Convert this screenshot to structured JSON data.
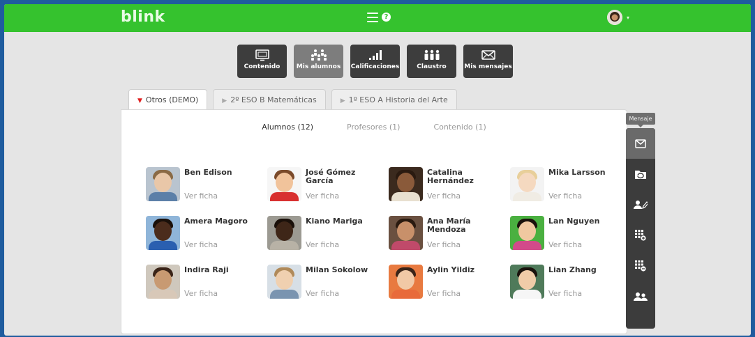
{
  "header": {
    "logo": "blink",
    "help_symbol": "?",
    "menu_icon": "hamburger-icon",
    "avatar_caret": "▾"
  },
  "toolbar": [
    {
      "label": "Contenido",
      "icon": "monitor-icon",
      "active": false
    },
    {
      "label": "Mis alumnos",
      "icon": "students-icon",
      "active": true
    },
    {
      "label": "Calificaciones",
      "icon": "bar-chart-icon",
      "active": false
    },
    {
      "label": "Claustro",
      "icon": "staff-icon",
      "active": false
    },
    {
      "label": "Mis mensajes",
      "icon": "envelope-icon",
      "active": false
    }
  ],
  "tabs": [
    {
      "label": "Otros (DEMO)",
      "active": true,
      "marker": "▼"
    },
    {
      "label": "2º ESO B Matemáticas",
      "active": false,
      "marker": "▶"
    },
    {
      "label": "1º ESO A Historia del Arte",
      "active": false,
      "marker": "▶"
    }
  ],
  "subtabs": [
    {
      "label": "Alumnos (12)",
      "active": true
    },
    {
      "label": "Profesores (1)",
      "active": false
    },
    {
      "label": "Contenido (1)",
      "active": false
    }
  ],
  "students_link_label": "Ver ficha",
  "students": [
    {
      "name": "Ben Edison",
      "skin": "#e9c7a8",
      "hair": "#8a6a45",
      "shirt": "#5b7fa8",
      "bg": "#b9c4cf"
    },
    {
      "name": "José Gómez García",
      "skin": "#f1c39b",
      "hair": "#7a4a2a",
      "shirt": "#d83030",
      "bg": "#f6f6f6"
    },
    {
      "name": "Catalina Hernández",
      "skin": "#8a5a3a",
      "hair": "#2a1a10",
      "shirt": "#e8e0d0",
      "bg": "#3b2a1e"
    },
    {
      "name": "Mika Larsson",
      "skin": "#f5d9c0",
      "hair": "#e8cf9a",
      "shirt": "#f0ece4",
      "bg": "#f3f3f3"
    },
    {
      "name": "Amera Magoro",
      "skin": "#4b2c1c",
      "hair": "#1a100a",
      "shirt": "#2a5fb0",
      "bg": "#8fb5d9"
    },
    {
      "name": "Kiano Mariga",
      "skin": "#3e2618",
      "hair": "#1a100a",
      "shirt": "#b8b2a6",
      "bg": "#9c9a92"
    },
    {
      "name": "Ana María Mendoza",
      "skin": "#c8906a",
      "hair": "#2a1a10",
      "shirt": "#c04a6a",
      "bg": "#6a5040"
    },
    {
      "name": "Lan Nguyen",
      "skin": "#f0c8a0",
      "hair": "#1a120c",
      "shirt": "#d24a8a",
      "bg": "#4ab040"
    },
    {
      "name": "Indira Raji",
      "skin": "#c89a72",
      "hair": "#3a2418",
      "shirt": "#d8c8b8",
      "bg": "#cfc8bd"
    },
    {
      "name": "Milan Sokolow",
      "skin": "#f0d0b0",
      "hair": "#b08a5a",
      "shirt": "#7a94b0",
      "bg": "#d7dfe6"
    },
    {
      "name": "Aylin Yildiz",
      "skin": "#f1c9a6",
      "hair": "#3a2418",
      "shirt": "#e86a3a",
      "bg": "#e87a40"
    },
    {
      "name": "Lian Zhang",
      "skin": "#f0cca8",
      "hair": "#1a120c",
      "shirt": "#f6f6f6",
      "bg": "#4f7a5a"
    }
  ],
  "sidebar": {
    "tooltip": "Mensaje",
    "buttons": [
      {
        "icon": "envelope-icon",
        "active": true
      },
      {
        "icon": "folder-sync-icon",
        "active": false
      },
      {
        "icon": "user-edit-icon",
        "active": false
      },
      {
        "icon": "grid-add-icon",
        "active": false
      },
      {
        "icon": "grid-remove-icon",
        "active": false
      },
      {
        "icon": "users-icon",
        "active": false
      }
    ]
  }
}
